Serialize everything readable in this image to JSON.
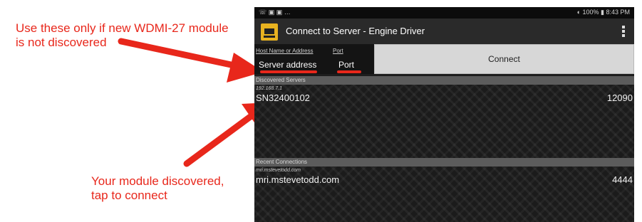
{
  "annotations": {
    "top_line1": "Use these only if new WDMI-27 module",
    "top_line2": "is not discovered",
    "bottom_line1": "Your module discovered,",
    "bottom_line2": "tap to connect",
    "color": "#e8271b"
  },
  "status_bar": {
    "left": "☏ ▣ ▣ …",
    "right": "◐ 100% ▮ 8:43 PM"
  },
  "app": {
    "title": "Connect to Server - Engine Driver",
    "icon": "engine-driver-app-icon",
    "menu_icon": "overflow-menu-icon"
  },
  "address_form": {
    "host_label": "Host Name or Address",
    "port_label": "Port",
    "server_placeholder": "Server address",
    "port_placeholder": "Port",
    "connect_label": "Connect"
  },
  "discovered": {
    "header": "Discovered Servers",
    "items": [
      {
        "address": "192.168.7.1",
        "name": "SN32400102",
        "port": "12090"
      }
    ]
  },
  "recent": {
    "header": "Recent Connections",
    "items": [
      {
        "address": "mri.mstevetodd.com",
        "name": "mri.mstevetodd.com",
        "port": "4444"
      }
    ]
  }
}
